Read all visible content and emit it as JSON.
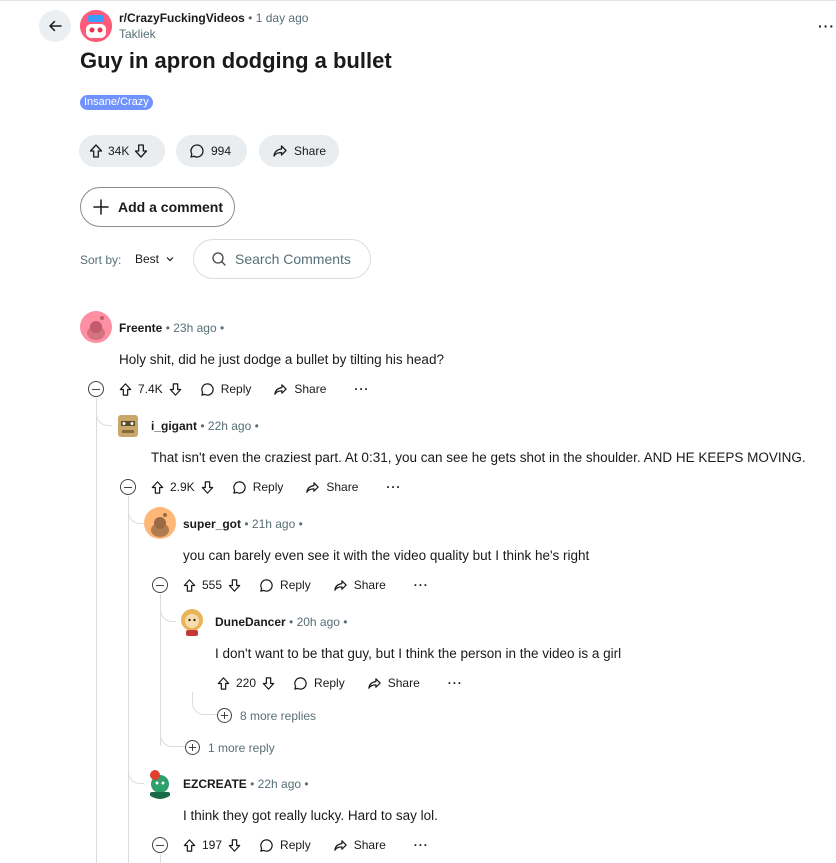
{
  "post": {
    "subreddit": "r/CrazyFuckingVideos",
    "time": "• 1 day ago",
    "author": "Takliek",
    "title": "Guy in apron dodging a bullet",
    "flair": "Insane/Crazy",
    "upvotes": "34K",
    "comments": "994",
    "share_label": "Share",
    "more_label": "···"
  },
  "add_comment_label": "Add a comment",
  "sort": {
    "label": "Sort by:",
    "value": "Best"
  },
  "search": {
    "placeholder": "Search Comments"
  },
  "comments": [
    {
      "author": "Freente",
      "time": "• 23h ago •",
      "body": "Holy shit, did he just dodge a bullet by tilting his head?",
      "votes": "7.4K",
      "reply": "Reply",
      "share": "Share",
      "more": "···"
    },
    {
      "author": "i_gigant",
      "time": "• 22h ago •",
      "body": "That isn't even the craziest part. At 0:31, you can see he gets shot in the shoulder. AND HE KEEPS MOVING.",
      "votes": "2.9K",
      "reply": "Reply",
      "share": "Share",
      "more": "···"
    },
    {
      "author": "super_got",
      "time": "• 21h ago •",
      "body": "you can barely even see it with the video quality but I think he's right",
      "votes": "555",
      "reply": "Reply",
      "share": "Share",
      "more": "···"
    },
    {
      "author": "DuneDancer",
      "time": "• 20h ago •",
      "body": "I don't want to be that guy, but I think the person in the video is a girl",
      "votes": "220",
      "reply": "Reply",
      "share": "Share",
      "more": "···"
    },
    {
      "author": "EZCREATE",
      "time": "• 22h ago •",
      "body": "I think they got really lucky. Hard to say lol.",
      "votes": "197",
      "reply": "Reply",
      "share": "Share",
      "more": "···"
    }
  ],
  "more_replies": [
    "8 more replies",
    "1 more reply"
  ],
  "icons": {
    "back": "arrow-left-icon",
    "upvote": "arrow-up-icon",
    "downvote": "arrow-down-icon",
    "comment": "speech-bubble-icon",
    "share": "share-arrow-icon",
    "plus": "plus-icon",
    "search": "magnifier-icon",
    "chevron": "chevron-down-icon",
    "collapse": "minus-circle-icon"
  },
  "colors": {
    "flair": "#7193ff",
    "pill_bg": "#eaedef",
    "meta_text": "#576f76",
    "thread_line": "#dadde0"
  }
}
